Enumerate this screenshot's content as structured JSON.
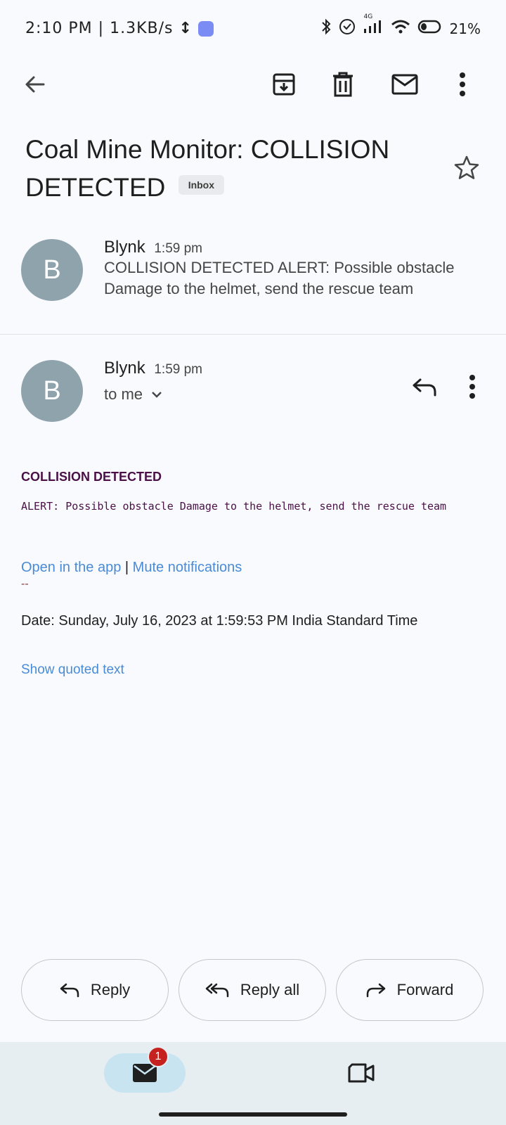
{
  "status_bar": {
    "time": "2:10 PM",
    "separator": "|",
    "net_speed": "1.3KB/s",
    "battery": "21%",
    "network_label": "4G"
  },
  "toolbar": {
    "back_icon": "arrow-back-icon",
    "archive_icon": "archive-icon",
    "delete_icon": "trash-icon",
    "mark_unread_icon": "mail-icon",
    "more_icon": "more-vert-icon"
  },
  "subject": {
    "text": "Coal Mine Monitor: COLLISION DETECTED",
    "label_chip": "Inbox"
  },
  "messages": [
    {
      "avatar_letter": "B",
      "sender": "Blynk",
      "time": "1:59 pm",
      "snippet": "COLLISION DETECTED ALERT: Possible obstacle Damage to the helmet, send the rescue team"
    },
    {
      "avatar_letter": "B",
      "sender": "Blynk",
      "time": "1:59 pm",
      "recipient": "to me"
    }
  ],
  "body": {
    "title": "COLLISION DETECTED",
    "alert_text": "ALERT: Possible obstacle Damage to the helmet, send the rescue team",
    "link_open": "Open in the app",
    "link_separator": "|",
    "link_mute": "Mute notifications",
    "signature_dashes": "--",
    "date_line": "Date: Sunday, July 16, 2023 at 1:59:53 PM India Standard Time",
    "show_quoted": "Show quoted text"
  },
  "actions": {
    "reply": "Reply",
    "reply_all": "Reply all",
    "forward": "Forward"
  },
  "bottom_nav": {
    "mail_badge": "1"
  },
  "colors": {
    "background": "#f8fafd",
    "avatar": "#8fa3ad",
    "link": "#4a8bd6",
    "body_text": "#4a1047",
    "badge": "#c5221f",
    "nav_bg": "#e6eef2",
    "nav_active": "#c9e4f1"
  }
}
